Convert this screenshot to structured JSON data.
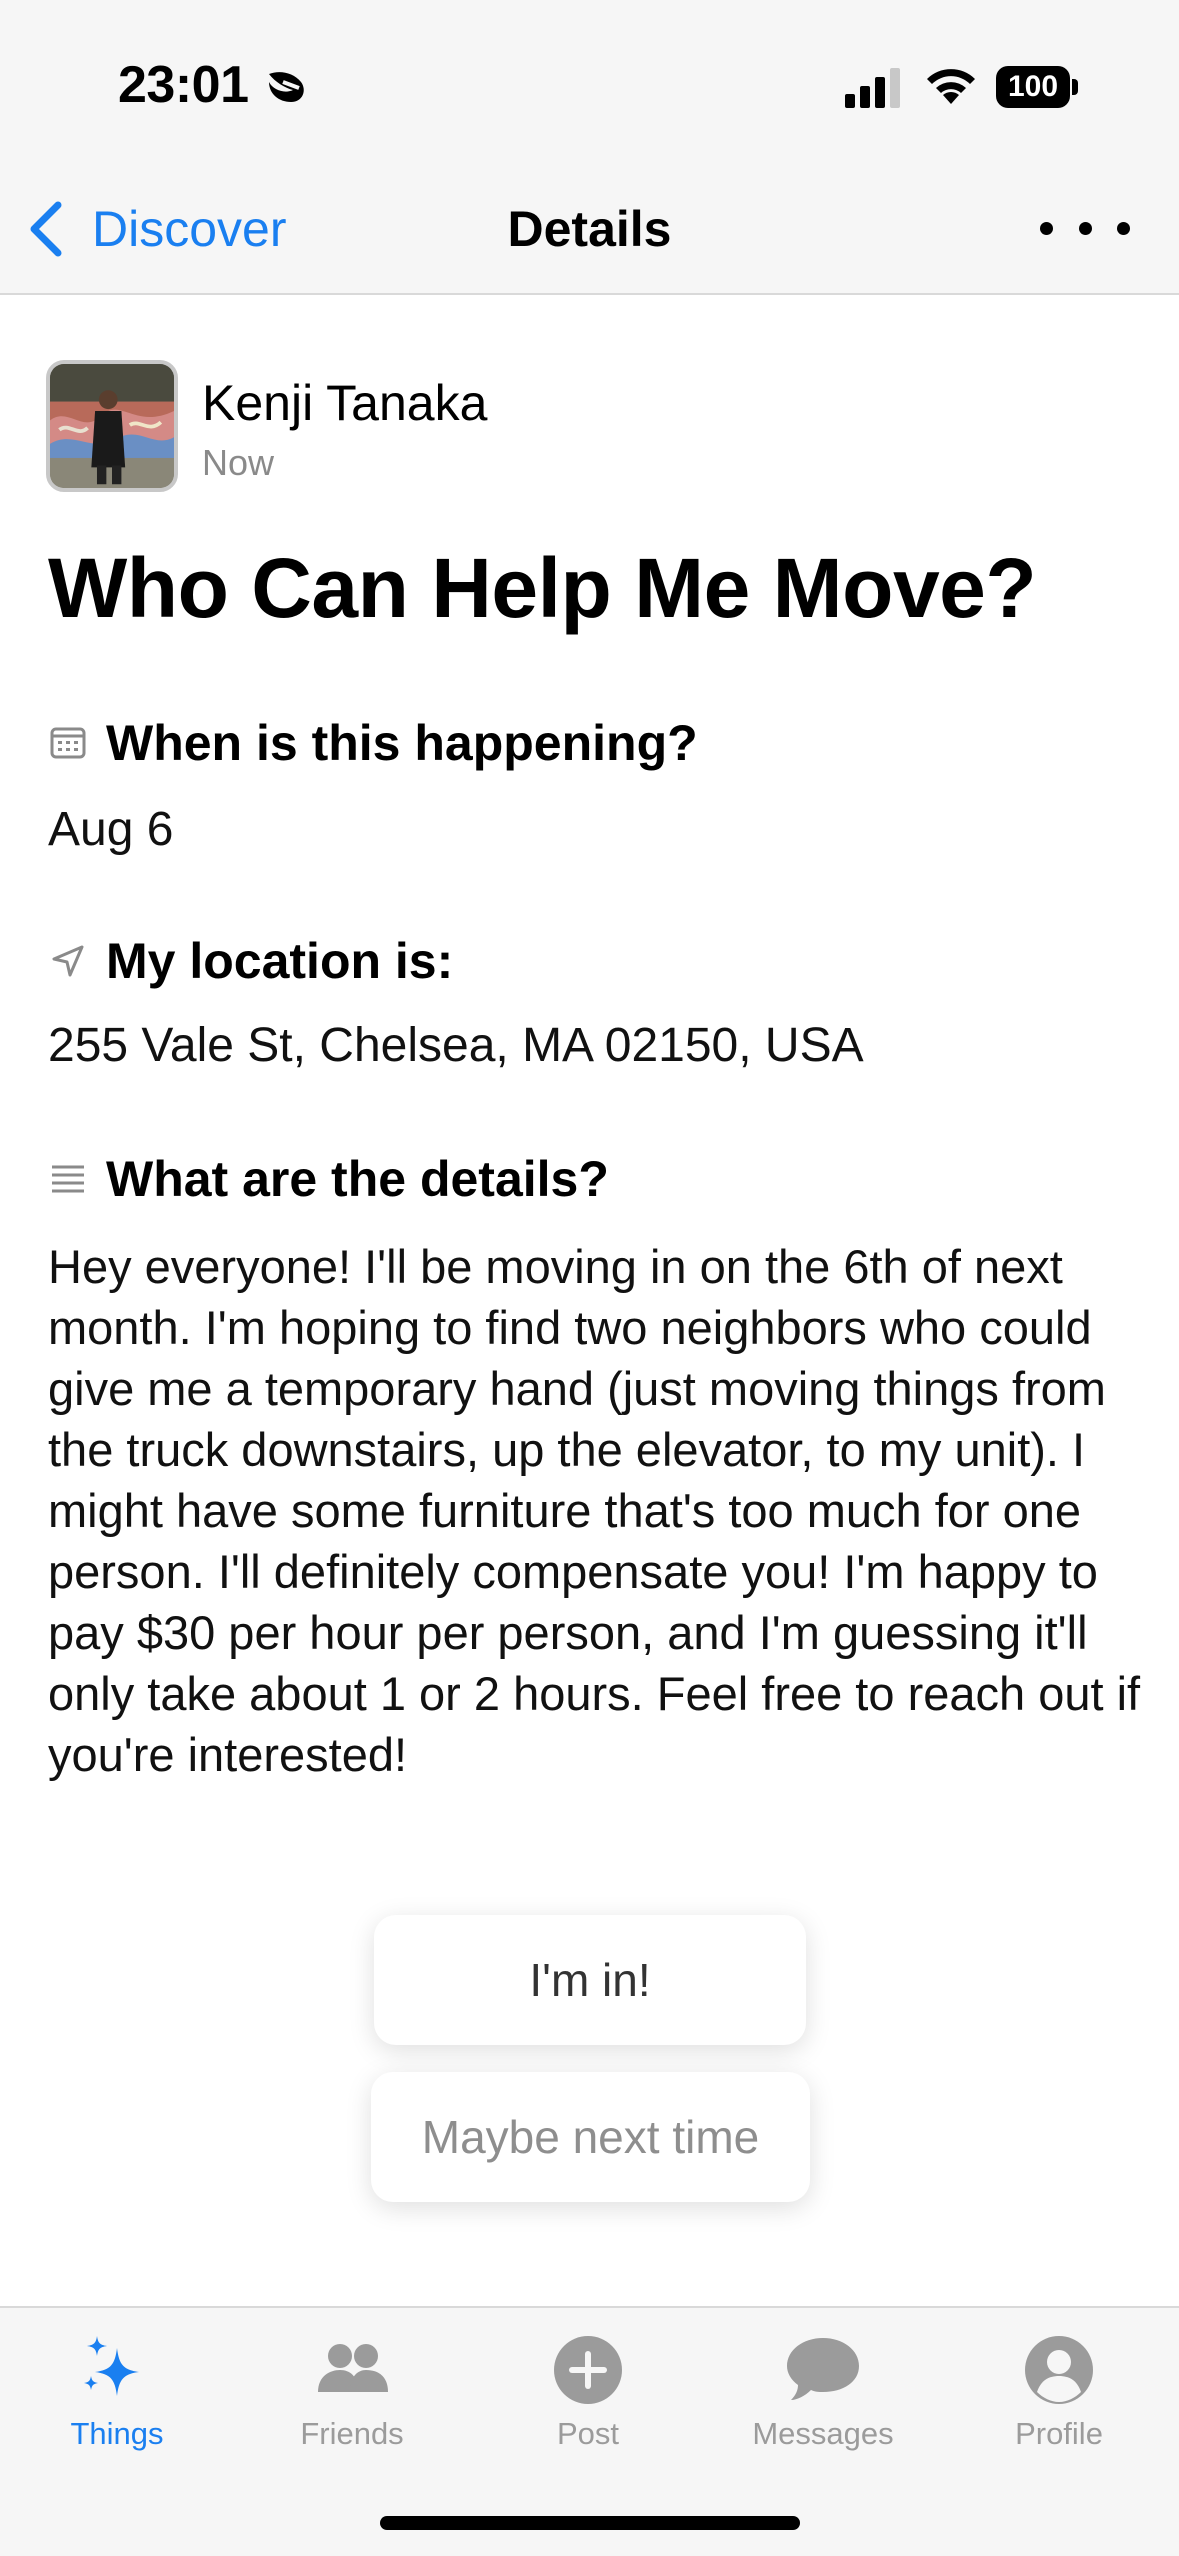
{
  "status_bar": {
    "time": "23:01",
    "battery": "100",
    "icons": [
      "moon-icon",
      "signal-icon",
      "wifi-icon",
      "battery-icon"
    ]
  },
  "nav": {
    "back_label": "Discover",
    "title": "Details",
    "more_icon": "ellipsis-icon"
  },
  "post": {
    "author": "Kenji Tanaka",
    "time": "Now",
    "title": "Who Can Help Me Move?",
    "when_heading": "When is this happening?",
    "when_value": "Aug 6",
    "location_heading": "My location is:",
    "location_value": "255 Vale St, Chelsea, MA 02150, USA",
    "details_heading": "What are the details?",
    "details_text": "Hey everyone! I'll be moving in on the 6th of next month. I'm hoping to find two neighbors who could give me a temporary hand (just moving things from the truck downstairs, up the elevator, to my unit). I might have some furniture that's too much for one person. I'll definitely compensate you! I'm happy to pay $30 per hour per person, and I'm guessing it'll only take about 1 or 2 hours. Feel free to reach out if you're interested!"
  },
  "actions": {
    "in_label": "I'm in!",
    "maybe_label": "Maybe next time"
  },
  "tabs": [
    {
      "label": "Things",
      "icon": "sparkles-icon",
      "active": true
    },
    {
      "label": "Friends",
      "icon": "people-icon",
      "active": false
    },
    {
      "label": "Post",
      "icon": "plus-circle-icon",
      "active": false
    },
    {
      "label": "Messages",
      "icon": "chat-bubble-icon",
      "active": false
    },
    {
      "label": "Profile",
      "icon": "person-circle-icon",
      "active": false
    }
  ],
  "colors": {
    "accent": "#1a7ff0",
    "inactive": "#9b9b9b",
    "bar_background": "#f6f6f6"
  }
}
